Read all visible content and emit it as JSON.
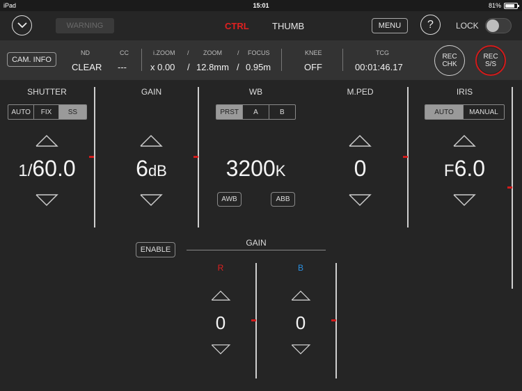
{
  "status_bar": {
    "device": "iPad",
    "time": "15:01",
    "battery": "81%",
    "battery_level": 0.81
  },
  "header": {
    "warning": "WARNING",
    "tabs": [
      {
        "label": "CTRL",
        "active": true
      },
      {
        "label": "THUMB",
        "active": false
      }
    ],
    "menu": "MENU",
    "help": "?",
    "lock_label": "LOCK",
    "lock_on": false
  },
  "info": {
    "cam_info": "CAM. INFO",
    "nd": {
      "label": "ND",
      "value": "CLEAR"
    },
    "cc": {
      "label": "CC",
      "value": "---"
    },
    "izoom": {
      "label": "i.ZOOM",
      "value": "x 0.00"
    },
    "zoom": {
      "label": "ZOOM",
      "value": "12.8mm"
    },
    "focus": {
      "label": "FOCUS",
      "value": "0.95m"
    },
    "slash": "/",
    "knee": {
      "label": "KNEE",
      "value": "OFF"
    },
    "tcg": {
      "label": "TCG",
      "value": "00:01:46.17"
    },
    "rec_chk": {
      "line1": "REC",
      "line2": "CHK"
    },
    "rec_ss": {
      "line1": "REC",
      "line2": "S/S"
    }
  },
  "shutter": {
    "title": "SHUTTER",
    "modes": [
      "AUTO",
      "FIX",
      "SS"
    ],
    "active_mode": "SS",
    "value_prefix": "1/",
    "value": "60.0"
  },
  "gain": {
    "title": "GAIN",
    "value": "6",
    "unit": "dB"
  },
  "wb": {
    "title": "WB",
    "modes": [
      "PRST",
      "A",
      "B"
    ],
    "active_mode": "PRST",
    "value": "3200",
    "unit": "K",
    "awb": "AWB",
    "abb": "ABB"
  },
  "mped": {
    "title": "M.PED",
    "value": "0"
  },
  "iris": {
    "title": "IRIS",
    "modes": [
      "AUTO",
      "MANUAL"
    ],
    "active_mode": "AUTO",
    "value_prefix": "F",
    "value": "6.0"
  },
  "gain_rb": {
    "enable": "ENABLE",
    "title": "GAIN",
    "r": {
      "label": "R",
      "value": "0",
      "color": "#e02020"
    },
    "b": {
      "label": "B",
      "value": "0",
      "color": "#2a8fe0"
    }
  },
  "colors": {
    "accent_red": "#e02020",
    "marker": "#d21b1b",
    "blue": "#2a8fe0"
  }
}
